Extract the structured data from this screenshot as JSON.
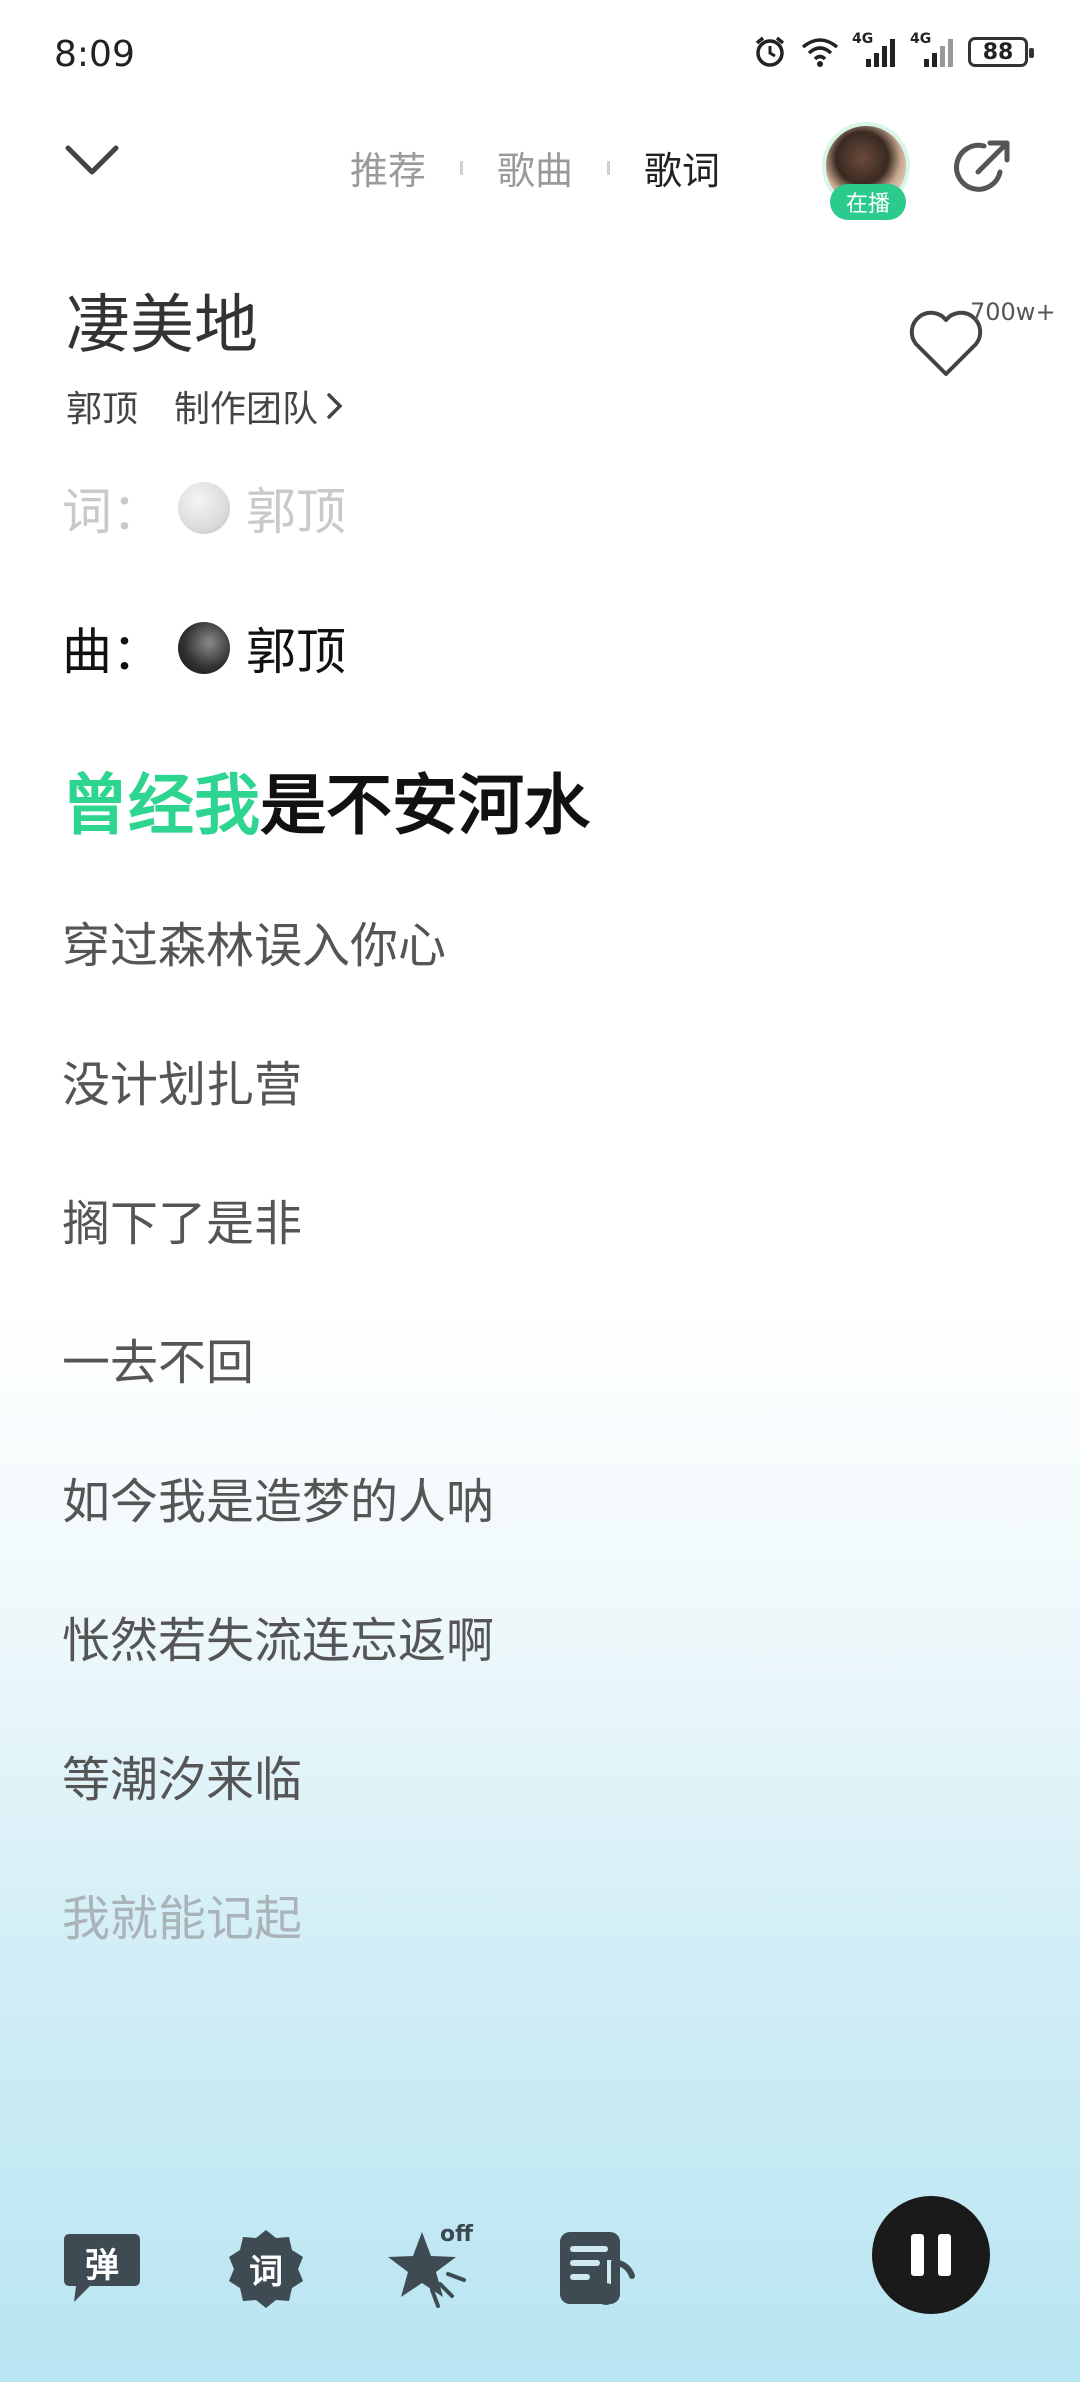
{
  "status_bar": {
    "time": "8:09",
    "network_label_1": "4G",
    "network_label_2": "4G",
    "battery": "88"
  },
  "header": {
    "tabs": [
      {
        "label": "推荐"
      },
      {
        "label": "歌曲"
      },
      {
        "label": "歌词"
      }
    ],
    "active_tab": "歌词",
    "live_badge": "在播"
  },
  "song": {
    "title": "凄美地",
    "artist": "郭顶",
    "credits_link": "制作团队",
    "like_count": "700w+"
  },
  "credits": {
    "lyricist_label": "词：",
    "lyricist": "郭顶",
    "composer_label": "曲：",
    "composer": "郭顶"
  },
  "lyrics": {
    "current_line_sung": "曾经我",
    "current_line_rest": "是不安河水",
    "upcoming": [
      "穿过森林误入你心",
      "没计划扎营",
      "搁下了是非",
      "一去不回",
      "如今我是造梦的人呐",
      "怅然若失流连忘返啊",
      "等潮汐来临",
      "我就能记起"
    ]
  },
  "toolbar": {
    "danmu_label": "弹",
    "lyrics_label": "词",
    "effect_state": "off"
  },
  "colors": {
    "accent": "#2ed591",
    "live_badge": "#2bcb8d"
  }
}
